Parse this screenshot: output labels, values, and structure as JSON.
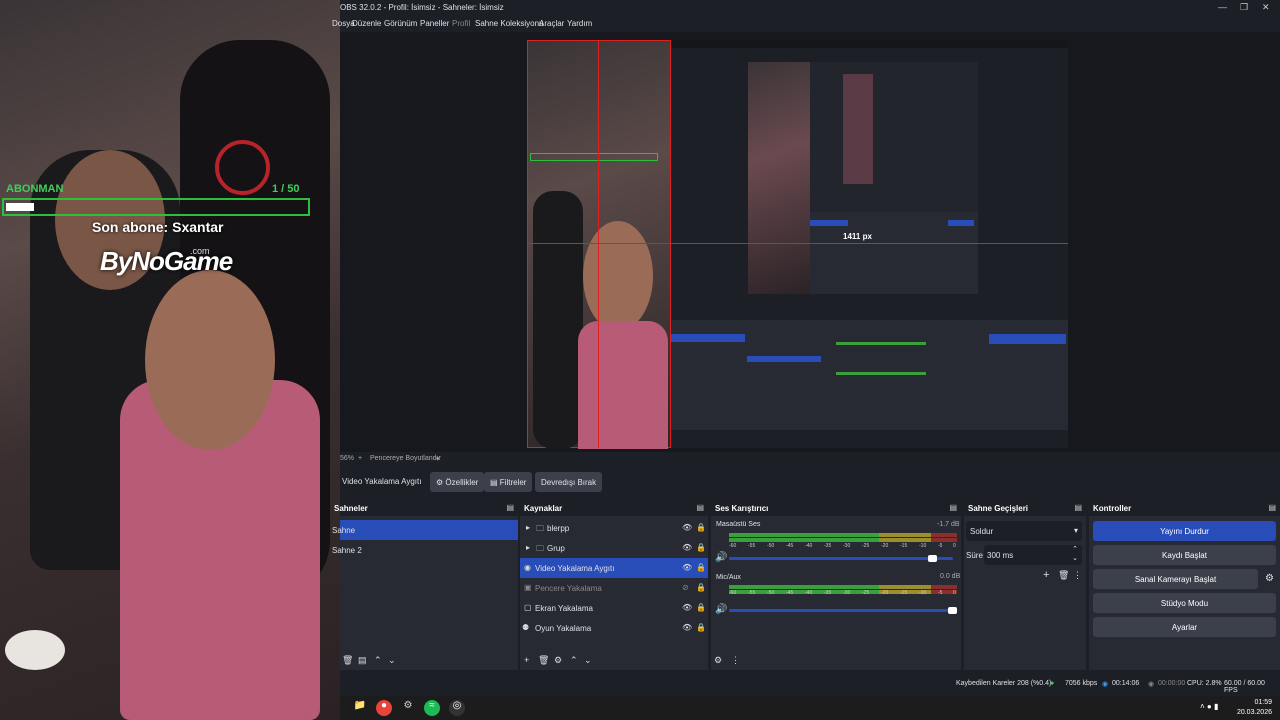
{
  "overlay": {
    "sub_label": "ABONMAN",
    "sub_count": "1 / 50",
    "sub_progress": 0.02,
    "last_sub": "Son abone: Sxantar",
    "brand": "ByNoGame",
    "brand_suffix": ".com"
  },
  "window": {
    "title": "OBS 32.0.2 - Profil: İsimsiz - Sahneler: İsimsiz",
    "menu": [
      "Dosya",
      "Düzenle",
      "Görünüm",
      "Paneller",
      "Profil",
      "Sahne Koleksiyonu",
      "Araçlar",
      "Yardım"
    ]
  },
  "preview": {
    "zoom": "56%",
    "fit_label": "Pencereye Boyutlandır",
    "nested_label": "1411 px"
  },
  "context_bar": {
    "source_name": "Video Yakalama Aygıtı",
    "properties": "Özellikler",
    "filters": "Filtreler",
    "deactivate": "Devredışı Bırak"
  },
  "scenes": {
    "title": "Sahneler",
    "items": [
      "Sahne",
      "Sahne 2"
    ]
  },
  "sources": {
    "title": "Kaynaklar",
    "items": [
      {
        "label": "blerpp",
        "type": "group"
      },
      {
        "label": "Grup",
        "type": "group"
      },
      {
        "label": "Video Yakalama Aygıtı",
        "type": "camera"
      },
      {
        "label": "Pencere Yakalama",
        "type": "window"
      },
      {
        "label": "Ekran Yakalama",
        "type": "display"
      },
      {
        "label": "Oyun Yakalama",
        "type": "game"
      }
    ]
  },
  "mixer": {
    "title": "Ses Karıştırıcı",
    "channels": [
      {
        "name": "Masaüstü Ses",
        "db": "-1.7 dB",
        "level": 0.92
      },
      {
        "name": "Mic/Aux",
        "db": "0.0 dB",
        "level": 0.98
      }
    ],
    "ticks": [
      "-60",
      "-55",
      "-50",
      "-45",
      "-40",
      "-35",
      "-30",
      "-25",
      "-20",
      "-15",
      "-10",
      "-5",
      "0"
    ]
  },
  "transitions": {
    "title": "Sahne Geçişleri",
    "selected": "Soldur",
    "duration_label": "Süre",
    "duration": "300 ms"
  },
  "controls": {
    "title": "Kontroller",
    "buttons": [
      "Yayını Durdur",
      "Kaydı Başlat",
      "Sanal Kamerayı Başlat",
      "Stüdyo Modu",
      "Ayarlar"
    ]
  },
  "status": {
    "dropped": "Kaybedilen Kareler 208 (%0.4)",
    "bitrate": "7056 kbps",
    "stream_time": "00:14:06",
    "rec_time": "00:00:00",
    "cpu": "CPU: 2.8%",
    "fps": "60.00 / 60.00 FPS"
  },
  "taskbar": {
    "time": "01:59",
    "date": "20.03.2026"
  }
}
